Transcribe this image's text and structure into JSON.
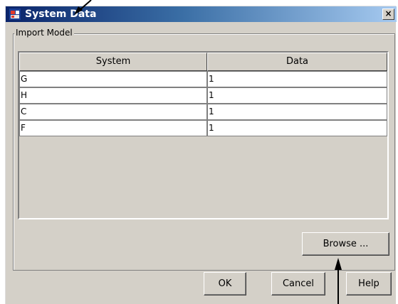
{
  "window": {
    "title": "System Data",
    "close_glyph": "×",
    "app_icon": "matlab-window-icon"
  },
  "import_model": {
    "group_label": "Import Model",
    "columns": [
      "System",
      "Data"
    ],
    "rows": [
      {
        "system": "G",
        "data": "1"
      },
      {
        "system": "H",
        "data": "1"
      },
      {
        "system": "C",
        "data": "1"
      },
      {
        "system": "F",
        "data": "1"
      }
    ],
    "browse_label": "Browse ..."
  },
  "footer": {
    "ok_label": "OK",
    "cancel_label": "Cancel",
    "help_label": "Help"
  },
  "colors": {
    "dialog_bg": "#d4d0c8",
    "title_start": "#0a246a",
    "title_end": "#a6caf0"
  }
}
